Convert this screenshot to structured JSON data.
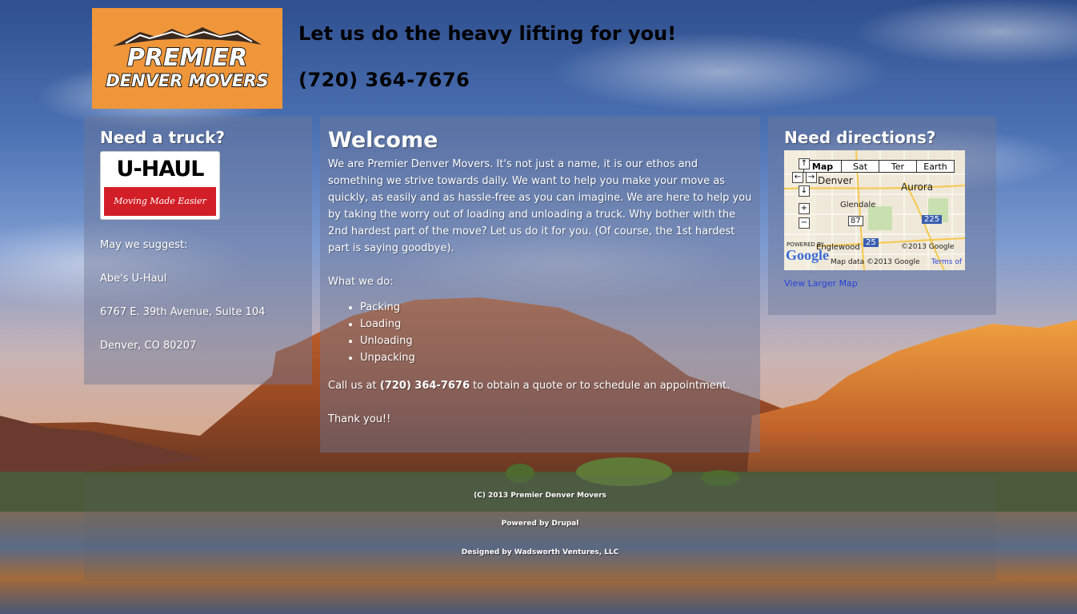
{
  "header": {
    "logo_text_line1": "PREMIER",
    "logo_text_line2": "DENVER MOVERS",
    "tagline": "Let us do the heavy lifting for you!",
    "phone": "(720) 364-7676"
  },
  "left_panel": {
    "title": "Need a truck?",
    "uhaul_logo": {
      "brand": "U-HAUL",
      "slogan": "Moving Made Easier"
    },
    "suggest": "May we suggest:",
    "business": "Abe's U-Haul",
    "address": "6767 E. 39th Avenue, Suite 104",
    "city": "Denver, CO 80207"
  },
  "center_panel": {
    "title": "Welcome",
    "intro": "We are Premier Denver Movers. It's not just a name, it is our ethos and something we strive towards daily. We want to help you make your move as quickly, as easily and as hassle-free as you can imagine. We are here to help you by taking the worry out of loading and unloading a truck. Why bother with the 2nd hardest part of the move? Let us do it for you. (Of course, the 1st hardest part is saying goodbye).",
    "what_we_do": "What we do:",
    "services": [
      "Packing",
      "Loading",
      "Unloading",
      "Unpacking"
    ],
    "call_prefix": "Call us at ",
    "call_phone": "(720) 364-7676",
    "call_suffix": " to obtain a quote or to schedule an appointment.",
    "thanks": "Thank you!!"
  },
  "right_panel": {
    "title": "Need directions?",
    "map": {
      "tabs": [
        "Map",
        "Sat",
        "Ter",
        "Earth"
      ],
      "selected_tab": "Map",
      "labels": {
        "denver": "Denver",
        "aurora": "Aurora",
        "glendale": "Glendale",
        "englewood": "Englewood",
        "highway_87": "87",
        "highway_225": "225",
        "highway_25": "25",
        "powered_by": "POWERED BY",
        "google": "Google",
        "copyright": "©2013 Google",
        "map_data": "Map data ©2013 Google",
        "terms": "Terms of"
      }
    },
    "larger_map_link": "View Larger Map"
  },
  "footer": {
    "copyright": "(C) 2013 Premier Denver Movers",
    "powered": "Powered by Drupal",
    "designed": "Designed by Wadsworth Ventures, LLC"
  },
  "colors": {
    "logo_background": "#f0963a",
    "panel_overlay": "rgba(110,120,150,0.45)",
    "link": "#2a43d8",
    "uhaul_red": "#d21f27"
  }
}
